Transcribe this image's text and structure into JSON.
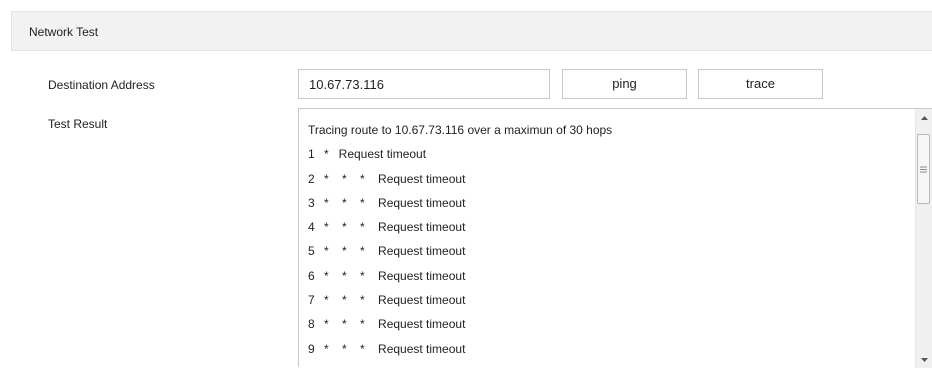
{
  "panel": {
    "title": "Network Test"
  },
  "form": {
    "destination_label": "Destination Address",
    "destination_value": "10.67.73.116",
    "ping_label": "ping",
    "trace_label": "trace",
    "result_label": "Test Result"
  },
  "result": {
    "header": "Tracing route to 10.67.73.116 over a maximun of 30 hops",
    "hops": [
      {
        "num": "1",
        "stars": "*   ",
        "text": "Request timeout"
      },
      {
        "num": "2",
        "stars": "*    *    *    ",
        "text": "Request timeout"
      },
      {
        "num": "3",
        "stars": "*    *    *    ",
        "text": "Request timeout"
      },
      {
        "num": "4",
        "stars": "*    *    *    ",
        "text": "Request timeout"
      },
      {
        "num": "5",
        "stars": "*    *    *    ",
        "text": "Request timeout"
      },
      {
        "num": "6",
        "stars": "*    *    *    ",
        "text": "Request timeout"
      },
      {
        "num": "7",
        "stars": "*    *    *    ",
        "text": "Request timeout"
      },
      {
        "num": "8",
        "stars": "*    *    *    ",
        "text": "Request timeout"
      },
      {
        "num": "9",
        "stars": "*    *    *    ",
        "text": "Request timeout"
      }
    ]
  },
  "icons": {
    "scroll_up": "scroll-up-arrow-icon",
    "scroll_down": "scroll-down-arrow-icon",
    "thumb_grip": "grip-icon"
  },
  "colors": {
    "header_bg": "#f2f2f2",
    "border": "#c9c9c9",
    "text": "#222222"
  }
}
